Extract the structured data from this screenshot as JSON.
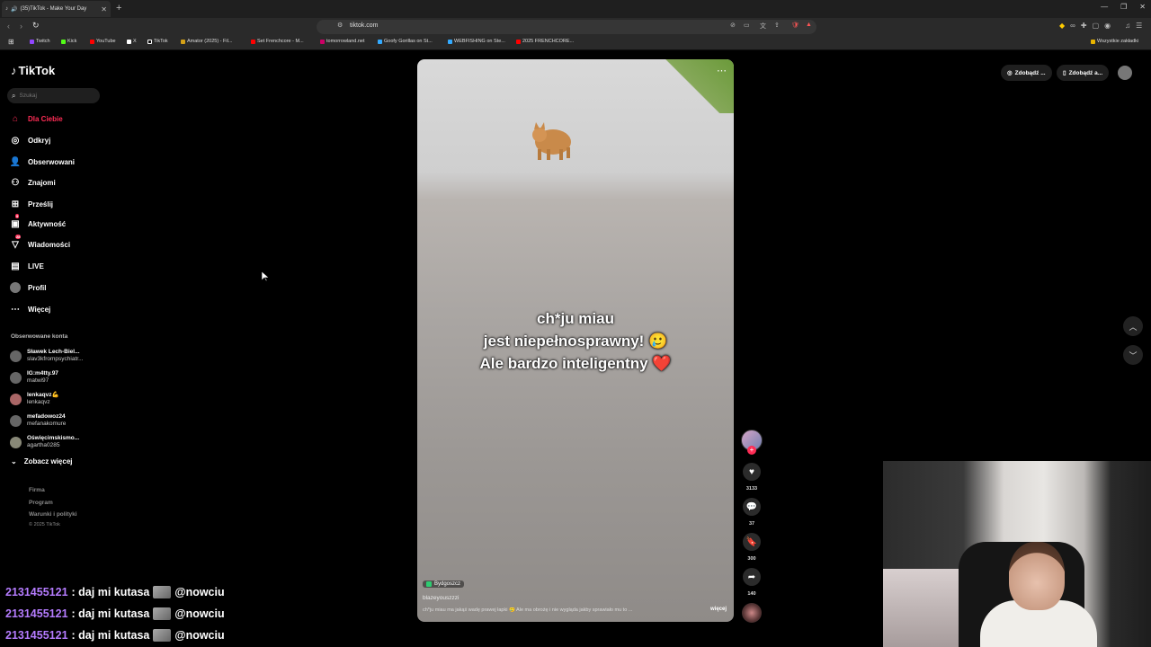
{
  "browser": {
    "tab_title": "(35)TikTok - Make Your Day",
    "url": "tiktok.com",
    "bookmarks": [
      "Twitch",
      "Kick",
      "YouTube",
      "X",
      "TikTok",
      "Amator (2025) - Fil...",
      "Set Frenchcore - M...",
      "tomorrowland.net",
      "Goofy Gorillas on St...",
      "WEBFISHING on Ste...",
      "2025 FRENCHCORE..."
    ],
    "all_bookmarks": "Wszystkie zakładki"
  },
  "sidebar": {
    "logo": "TikTok",
    "search_placeholder": "Szukaj",
    "nav": [
      {
        "label": "Dla Ciebie",
        "icon": "home-icon"
      },
      {
        "label": "Odkryj",
        "icon": "compass-icon"
      },
      {
        "label": "Obserwowani",
        "icon": "following-icon"
      },
      {
        "label": "Znajomi",
        "icon": "friends-icon"
      },
      {
        "label": "Prześlij",
        "icon": "upload-icon"
      },
      {
        "label": "Aktywność",
        "icon": "activity-icon",
        "badge": "9"
      },
      {
        "label": "Wiadomości",
        "icon": "messages-icon",
        "badge": "28"
      },
      {
        "label": "LIVE",
        "icon": "live-icon"
      },
      {
        "label": "Profil",
        "icon": "profile-icon"
      },
      {
        "label": "Więcej",
        "icon": "more-icon"
      }
    ],
    "following_title": "Obserwowane konta",
    "following": [
      {
        "name": "Sławek Lech-Biel...",
        "handle": "slav3kfrompsychiatr..."
      },
      {
        "name": "IG:m4tty.97",
        "handle": "matwi97"
      },
      {
        "name": "lenkaqvz💪",
        "handle": "lenkaqvz"
      },
      {
        "name": "mefadowoz24",
        "handle": "mefanakomure"
      },
      {
        "name": "Oświęcimskismo...",
        "handle": "agartha0285"
      }
    ],
    "see_more": "Zobacz więcej",
    "footer": [
      "Firma",
      "Program",
      "Warunki i polityki"
    ],
    "copyright": "© 2025 TikTok"
  },
  "video": {
    "overlay_lines": [
      "ch*ju miau",
      "jest niepełnosprawny! 🥲",
      "Ale bardzo inteligentny ❤️"
    ],
    "location": "Bydgoszcz",
    "username": "blazeyouszzzi",
    "description": "ch*ju miau ma jakąś wadę prawej łapki 🥲 Ale ma obrożę i nie wygląda jakby sprawiało mu to ...",
    "more": "więcej"
  },
  "actions": {
    "likes": "3133",
    "comments": "37",
    "saves": "300",
    "shares": "140"
  },
  "topright": {
    "btn1": "Zdobądź ...",
    "btn2": "Zdobądź a..."
  },
  "chat": [
    {
      "user": "2131455121",
      "msg": ": daj mi kutasa",
      "mention": "@nowciu"
    },
    {
      "user": "2131455121",
      "msg": ": daj mi kutasa",
      "mention": "@nowciu"
    },
    {
      "user": "2131455121",
      "msg": ": daj mi kutasa",
      "mention": "@nowciu"
    }
  ]
}
